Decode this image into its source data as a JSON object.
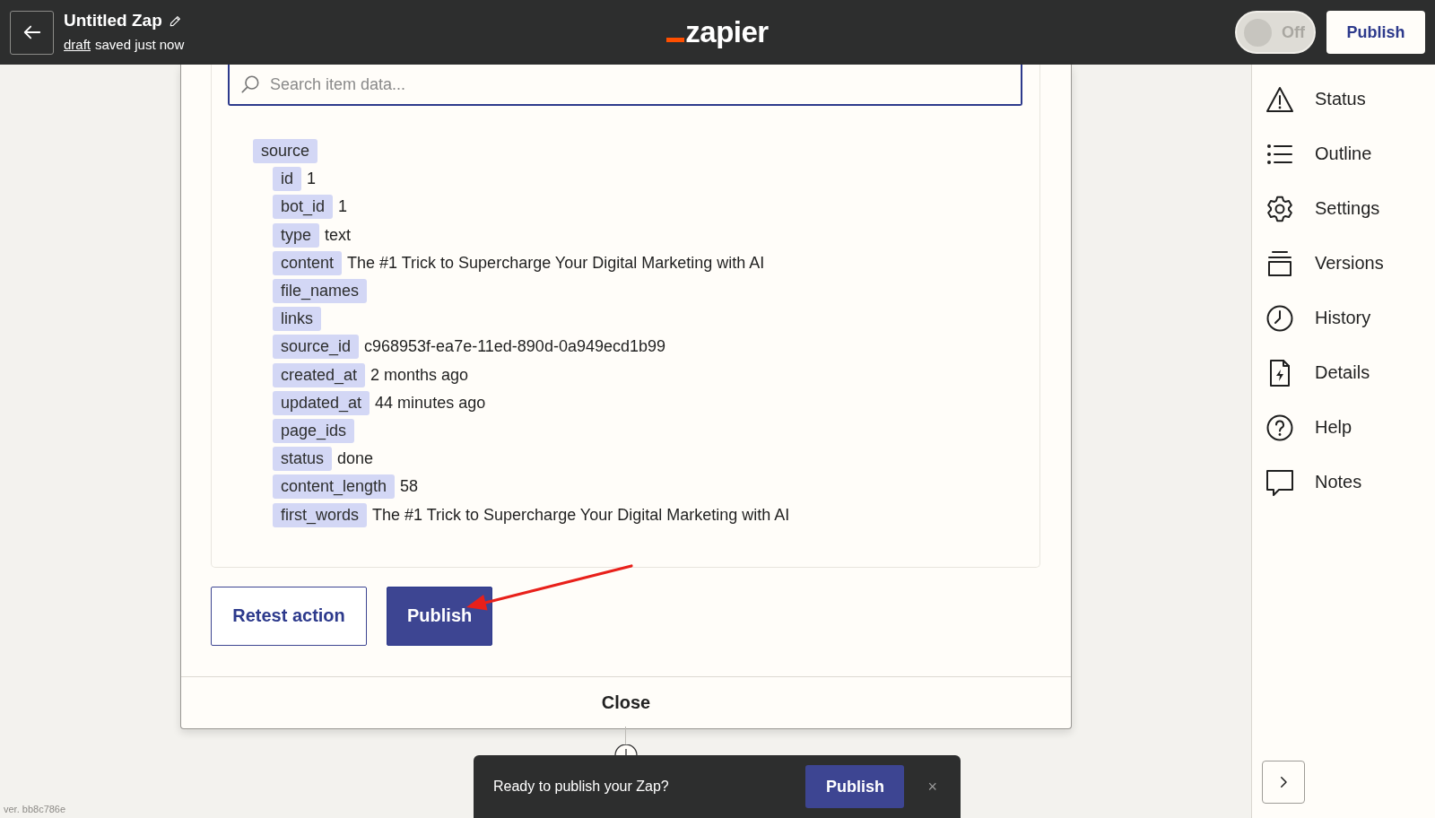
{
  "header": {
    "title": "Untitled Zap",
    "draft_link": "draft",
    "save_status": "saved just now",
    "logo": "zapier",
    "toggle": {
      "label": "Off",
      "on": false
    },
    "publish_button": "Publish"
  },
  "search": {
    "placeholder": "Search item data..."
  },
  "data_tree": [
    {
      "key": "source",
      "children": [
        {
          "key": "id",
          "value": "1"
        },
        {
          "key": "bot_id",
          "value": "1"
        },
        {
          "key": "type",
          "value": "text"
        },
        {
          "key": "content",
          "value": "The #1 Trick to Supercharge Your Digital Marketing with AI"
        },
        {
          "key": "file_names"
        },
        {
          "key": "links"
        },
        {
          "key": "source_id",
          "value": "c968953f-ea7e-11ed-890d-0a949ecd1b99"
        },
        {
          "key": "created_at",
          "value": "2 months ago"
        },
        {
          "key": "updated_at",
          "value": "44 minutes ago"
        },
        {
          "key": "page_ids"
        },
        {
          "key": "status",
          "value": "done"
        },
        {
          "key": "content_length",
          "value": "58"
        },
        {
          "key": "first_words",
          "value": "The #1 Trick to Supercharge Your Digital Marketing with AI"
        }
      ]
    }
  ],
  "buttons": [
    {
      "label": "Retest action",
      "kind": "secondary"
    },
    {
      "label": "Publish",
      "kind": "primary"
    }
  ],
  "close_button": "Close",
  "sidebar": {
    "items": [
      {
        "label": "Status",
        "kind": "status"
      },
      {
        "label": "Outline",
        "kind": "outline"
      },
      {
        "label": "Settings",
        "kind": "settings"
      },
      {
        "label": "Versions",
        "kind": "versions"
      },
      {
        "label": "History",
        "kind": "history"
      },
      {
        "label": "Details",
        "kind": "details"
      },
      {
        "label": "Help",
        "kind": "help"
      },
      {
        "label": "Notes",
        "kind": "notes"
      }
    ]
  },
  "toast": {
    "text": "Ready to publish your Zap?",
    "button": "Publish",
    "close": "×"
  },
  "version": "ver. bb8c786e"
}
